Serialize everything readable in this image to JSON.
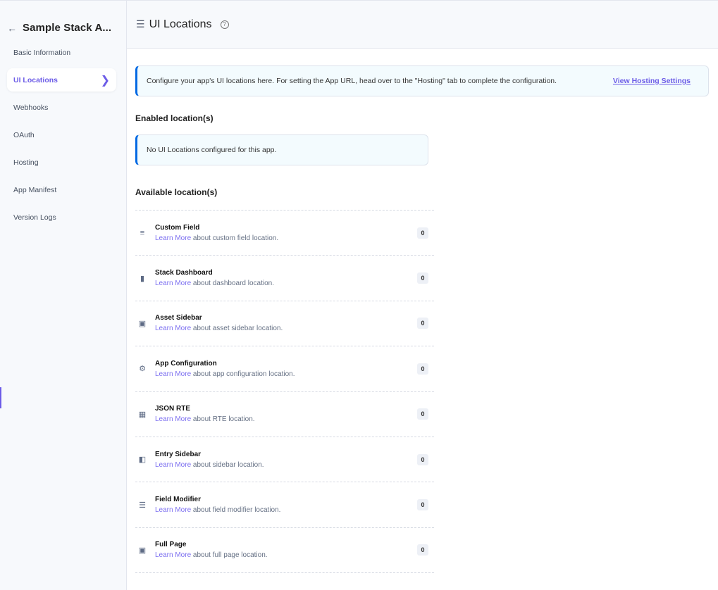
{
  "sidebar": {
    "title": "Sample Stack A...",
    "items": [
      {
        "label": "Basic Information"
      },
      {
        "label": "UI Locations",
        "active": true
      },
      {
        "label": "Webhooks"
      },
      {
        "label": "OAuth"
      },
      {
        "label": "Hosting"
      },
      {
        "label": "App Manifest"
      },
      {
        "label": "Version Logs"
      }
    ]
  },
  "header": {
    "title": "UI Locations",
    "help": "?"
  },
  "info": {
    "text": "Configure your app's UI locations here. For setting the App URL, head over to the \"Hosting\" tab to complete the configuration.",
    "link": "View Hosting Settings"
  },
  "enabled": {
    "title": "Enabled location(s)",
    "empty": "No UI Locations configured for this app."
  },
  "available": {
    "title": "Available location(s)",
    "learn_more": "Learn More",
    "items": [
      {
        "name": "Custom Field",
        "desc": " about custom field location.",
        "count": "0",
        "icon": "custom-field-icon"
      },
      {
        "name": "Stack Dashboard",
        "desc": " about dashboard location.",
        "count": "0",
        "icon": "dashboard-icon"
      },
      {
        "name": "Asset Sidebar",
        "desc": " about asset sidebar location.",
        "count": "0",
        "icon": "asset-sidebar-icon"
      },
      {
        "name": "App Configuration",
        "desc": " about app configuration location.",
        "count": "0",
        "icon": "gear-icon"
      },
      {
        "name": "JSON RTE",
        "desc": " about RTE location.",
        "count": "0",
        "icon": "rte-icon"
      },
      {
        "name": "Entry Sidebar",
        "desc": " about sidebar location.",
        "count": "0",
        "icon": "entry-sidebar-icon"
      },
      {
        "name": "Field Modifier",
        "desc": " about field modifier location.",
        "count": "0",
        "icon": "field-modifier-icon"
      },
      {
        "name": "Full Page",
        "desc": " about full page location.",
        "count": "0",
        "icon": "full-page-icon"
      }
    ]
  },
  "colors": {
    "accent": "#6c5ce7",
    "info_border": "#0469e3"
  }
}
